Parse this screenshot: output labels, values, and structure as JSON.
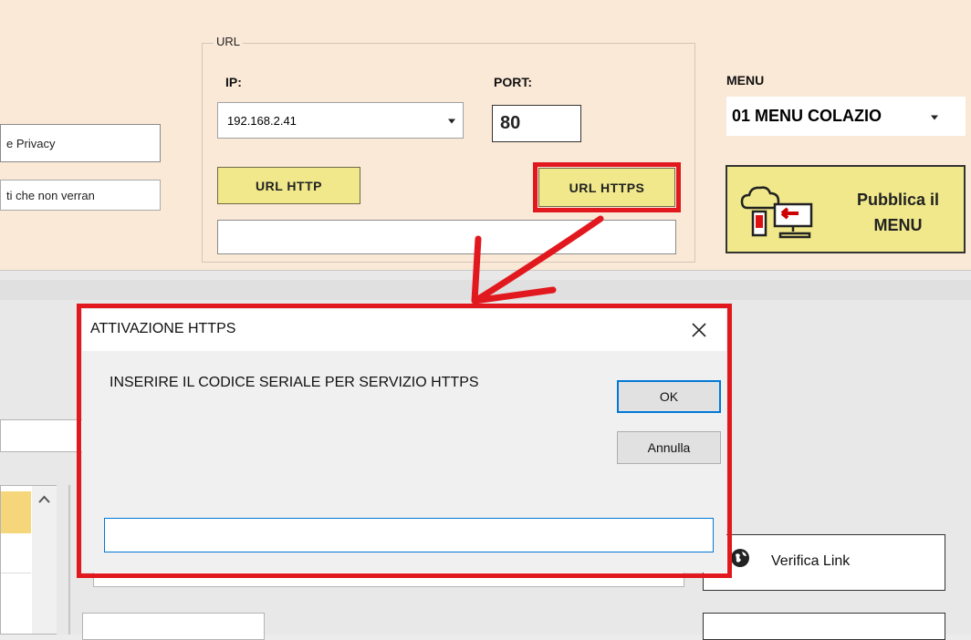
{
  "left_fields": {
    "privacy_text": "e Privacy",
    "notice_text": "ti che non verran"
  },
  "url_group": {
    "legend": "URL",
    "ip_label": "IP:",
    "ip_value": "192.168.2.41",
    "port_label": "PORT:",
    "port_value": "80",
    "url_http_label": "URL HTTP",
    "url_https_label": "URL HTTPS",
    "url_output_value": ""
  },
  "menu": {
    "label": "MENU",
    "selected": "01 MENU COLAZIO",
    "publish_label": "Pubblica il MENU"
  },
  "dialog": {
    "title": "ATTIVAZIONE HTTPS",
    "message": "INSERIRE IL CODICE SERIALE PER SERVIZIO HTTPS",
    "ok_label": "OK",
    "cancel_label": "Annulla",
    "input_value": ""
  },
  "side_buttons": {
    "verify_link_label": "Verifica Link"
  },
  "colors": {
    "panel_bg": "#fbe9d7",
    "button_yellow": "#f0e88a",
    "highlight_red": "#e1191f",
    "dialog_bg": "#f0f0f0"
  },
  "icons": [
    "cloud-upload-computer-icon",
    "globe-icon",
    "close-icon",
    "chevron-down-icon",
    "chevron-up-icon"
  ]
}
